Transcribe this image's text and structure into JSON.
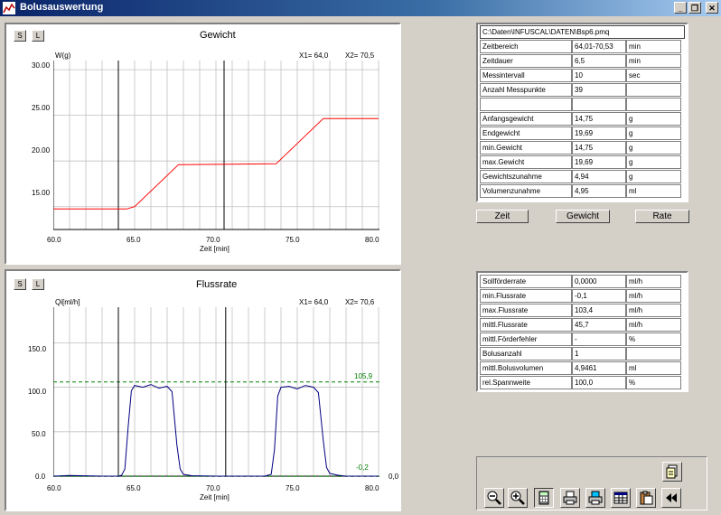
{
  "window": {
    "title": "Bolusauswertung",
    "minimize": "_",
    "restore": "❐",
    "close": "✕"
  },
  "chart1": {
    "title": "Gewicht",
    "s": "S",
    "l": "L",
    "ylabel": "W(g)",
    "xlabel": "Zeit [min]",
    "x1_label": "X1= 64,0",
    "x2_label": "X2= 70,5",
    "yticks": [
      "30.00",
      "25.00",
      "20.00",
      "15.00"
    ],
    "xticks": [
      "60.0",
      "65.0",
      "70.0",
      "75.0",
      "80.0"
    ]
  },
  "chart2": {
    "title": "Flussrate",
    "s": "S",
    "l": "L",
    "ylabel": "Qi[ml/h]",
    "xlabel": "Zeit [min]",
    "x1_label": "X1= 64,0",
    "x2_label": "X2= 70,6",
    "yticks": [
      "150.0",
      "100.0",
      "50.0",
      "0.0"
    ],
    "xticks": [
      "60.0",
      "65.0",
      "70.0",
      "75.0",
      "80.0"
    ],
    "max_label": "105,9",
    "min_label": "-0,2",
    "right_zero": "0,0"
  },
  "chart_data": [
    {
      "type": "line",
      "title": "Gewicht",
      "xlabel": "Zeit [min]",
      "ylabel": "W(g)",
      "xlim": [
        60,
        80
      ],
      "ylim": [
        12.5,
        31
      ],
      "series": [
        {
          "x": [
            60,
            64.5,
            65,
            67.7,
            73.7,
            76.6,
            80
          ],
          "y": [
            14.75,
            14.75,
            15.0,
            19.6,
            19.69,
            24.65,
            24.65
          ],
          "color": "#ff0000"
        }
      ],
      "markers_x": [
        64.0,
        70.5
      ]
    },
    {
      "type": "line",
      "title": "Flussrate",
      "xlabel": "Zeit [min]",
      "ylabel": "Qi[ml/h]",
      "xlim": [
        60,
        80
      ],
      "ylim": [
        0,
        190
      ],
      "series": [
        {
          "x": [
            60,
            61,
            62,
            63,
            64,
            64.2,
            64.4,
            64.6,
            64.8,
            65,
            65.5,
            66,
            66.5,
            67,
            67.3,
            67.6,
            67.8,
            68,
            68.5,
            70,
            73,
            73.4,
            73.6,
            73.8,
            74,
            74.5,
            75,
            75.5,
            76,
            76.3,
            76.6,
            76.8,
            77,
            77.5,
            78,
            80
          ],
          "y": [
            0,
            0.8,
            0.4,
            0,
            0,
            1,
            8,
            55,
            96,
            102,
            100,
            103,
            99,
            101,
            95,
            35,
            8,
            2,
            0.5,
            0,
            0,
            2,
            30,
            90,
            100,
            101,
            98,
            102,
            100,
            94,
            40,
            10,
            3,
            1,
            0,
            0
          ],
          "color": "#000080"
        }
      ],
      "reference_lines": [
        {
          "y": 105.9,
          "color": "#008000"
        },
        {
          "y": -0.2,
          "color": "#008000"
        }
      ],
      "markers_x": [
        64.0,
        70.6
      ]
    }
  ],
  "file_path": "C:\\Daten\\INFUSCAL\\DATEN\\Bsp6.pmq",
  "table1": [
    [
      "Zeitbereich",
      "64,01-70,53",
      "min"
    ],
    [
      "Zeitdauer",
      "6,5",
      "min"
    ],
    [
      "Messintervall",
      "10",
      "sec"
    ],
    [
      "Anzahl Messpunkte",
      "39",
      ""
    ],
    [
      "",
      "",
      ""
    ],
    [
      "Anfangsgewicht",
      "14,75",
      "g"
    ],
    [
      "Endgewicht",
      "19,69",
      "g"
    ],
    [
      "min.Gewicht",
      "14,75",
      "g"
    ],
    [
      "max.Gewicht",
      "19,69",
      "g"
    ],
    [
      "Gewichtszunahme",
      "4,94",
      "g"
    ],
    [
      "Volumenzunahme",
      "4,95",
      "ml"
    ]
  ],
  "buttons": {
    "zeit": "Zeit",
    "gewicht": "Gewicht",
    "rate": "Rate"
  },
  "table2": [
    [
      "Sollförderrate",
      "0,0000",
      "ml/h"
    ],
    [
      "min.Flussrate",
      "-0,1",
      "ml/h"
    ],
    [
      "max.Flussrate",
      "103,4",
      "ml/h"
    ],
    [
      "mittl.Flussrate",
      "45,7",
      "ml/h"
    ],
    [
      "mittl.Förderfehler",
      "-",
      "%"
    ],
    [
      "Bolusanzahl",
      "1",
      ""
    ],
    [
      "mittl.Bolusvolumen",
      "4,9461",
      "ml"
    ],
    [
      "rel.Spannweite",
      "100,0",
      "%"
    ]
  ],
  "toolbar_icons": [
    "copy-icon",
    "zoom-out-icon",
    "zoom-in-icon",
    "calculator-icon",
    "print-icon",
    "print-color-icon",
    "table-icon",
    "clipboard-icon",
    "rewind-icon"
  ]
}
